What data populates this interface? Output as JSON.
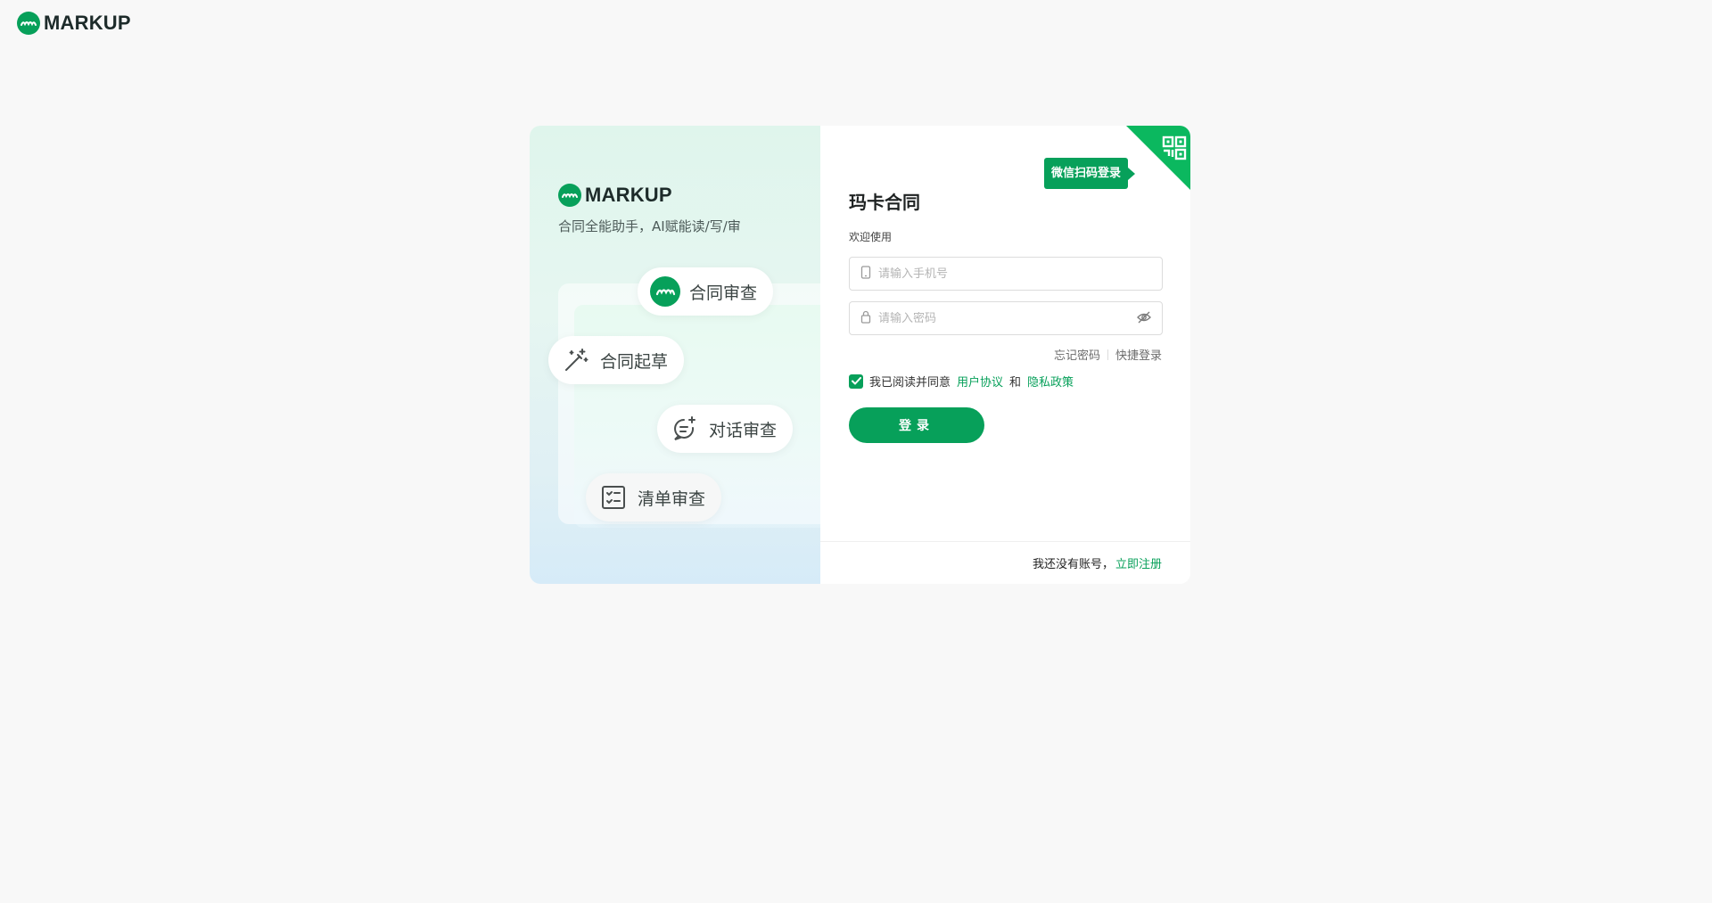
{
  "brand": {
    "name": "MARKUP",
    "logo_icon": "markup-logo-icon"
  },
  "left_panel": {
    "slogan": "合同全能助手，AI赋能读/写/审",
    "features": [
      {
        "label": "合同审查",
        "icon": "markup-logo-icon"
      },
      {
        "label": "合同起草",
        "icon": "magic-wand-icon"
      },
      {
        "label": "对话审查",
        "icon": "chat-sparkle-icon"
      },
      {
        "label": "清单审查",
        "icon": "checklist-icon"
      }
    ]
  },
  "login": {
    "wechat_tooltip": "微信扫码登录",
    "title": "玛卡合同",
    "welcome": "欢迎使用",
    "phone_placeholder": "请输入手机号",
    "password_placeholder": "请输入密码",
    "forgot_password": "忘记密码",
    "quick_login": "快捷登录",
    "agree_prefix": "我已阅读并同意",
    "user_agreement": "用户协议",
    "and": "和",
    "privacy_policy": "隐私政策",
    "login_button": "登录",
    "no_account": "我还没有账号，",
    "register": "立即注册"
  },
  "colors": {
    "primary": "#07a05a",
    "corner_green": "#0bb85f"
  }
}
